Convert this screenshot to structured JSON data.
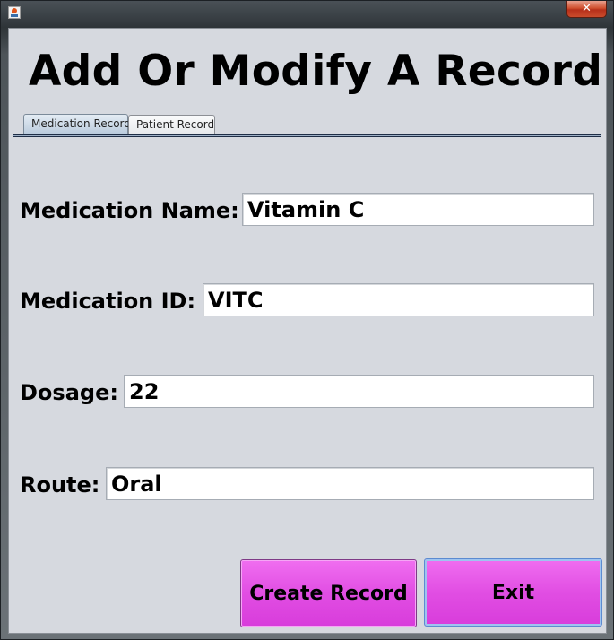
{
  "window": {
    "close_symbol": "✕"
  },
  "title": "Add Or Modify A Record",
  "tabs": [
    {
      "label": "Medication Record",
      "selected": true
    },
    {
      "label": "Patient Record",
      "selected": false
    }
  ],
  "form": {
    "fields": [
      {
        "label": "Medication Name:",
        "value": "Vitamin C"
      },
      {
        "label": "Medication ID:",
        "value": "VITC"
      },
      {
        "label": "Dosage:",
        "value": "22"
      },
      {
        "label": "Route:",
        "value": "Oral"
      }
    ]
  },
  "buttons": {
    "create_label": "Create Record",
    "exit_label": "Exit"
  },
  "colors": {
    "button_magenta": "#e14ee3",
    "panel_background": "#d6d9df",
    "tab_selected": "#b7c9db"
  }
}
